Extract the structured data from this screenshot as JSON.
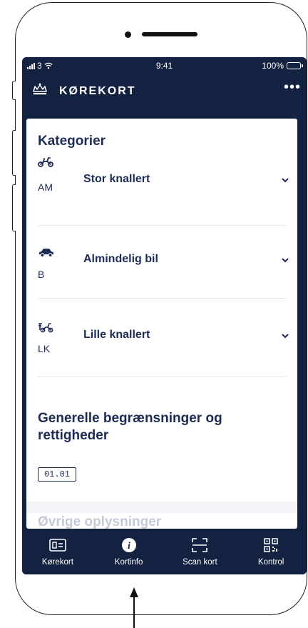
{
  "statusbar": {
    "signal": "3",
    "time": "9:41",
    "battery": "100%"
  },
  "appbar": {
    "title": "KØREKORT",
    "more_label": "•••"
  },
  "main": {
    "section_title": "Kategorier",
    "categories": [
      {
        "code": "AM",
        "label": "Stor knallert",
        "icon": "moped-icon"
      },
      {
        "code": "B",
        "label": "Almindelig bil",
        "icon": "car-icon"
      },
      {
        "code": "LK",
        "label": "Lille knallert",
        "icon": "small-moped-icon"
      }
    ],
    "restrictions_title": "Generelle begrænsninger og rettigheder",
    "restriction_codes": [
      "01.01"
    ],
    "next_section_peek": "Øvrige oplysninger"
  },
  "nav": {
    "items": [
      {
        "label": "Kørekort",
        "icon": "license-card-icon"
      },
      {
        "label": "Kortinfo",
        "icon": "info-icon"
      },
      {
        "label": "Scan kort",
        "icon": "scan-icon"
      },
      {
        "label": "Kontrol",
        "icon": "qr-code-icon"
      }
    ]
  },
  "colors": {
    "header_bg": "#132241",
    "text_primary": "#1d2b55",
    "card_bg": "#ffffff"
  }
}
